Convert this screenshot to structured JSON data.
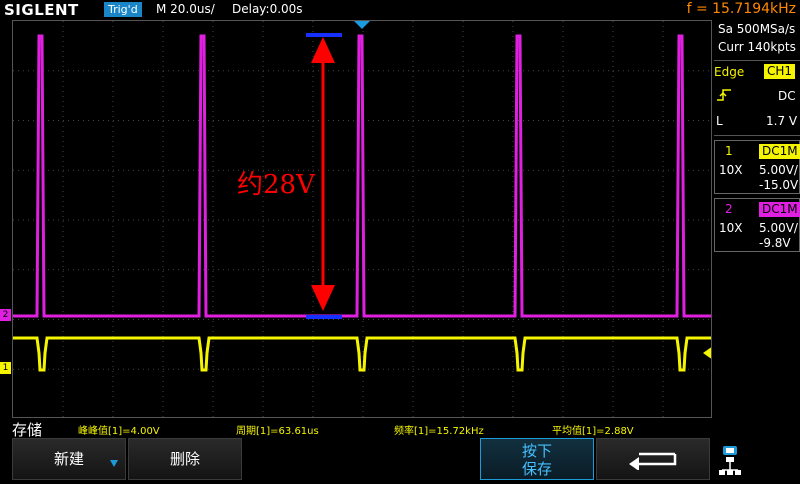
{
  "header": {
    "brand": "SIGLENT",
    "trigger_status": "Trig'd",
    "timebase": "M 20.0us/",
    "delay": "Delay:0.00s",
    "frequency": "f = 15.7194kHz"
  },
  "side_panel": {
    "sample_rate": "Sa 500MSa/s",
    "memory_depth": "Curr 140kpts",
    "trigger": {
      "type_label": "Edge",
      "source": "CH1",
      "coupling": "DC",
      "level_label": "L",
      "level": "1.7 V"
    },
    "channels": [
      {
        "number": "1",
        "coupling": "DC1M",
        "probe": "10X",
        "scale": "5.00V/",
        "offset": "-15.0V",
        "color": "#f5f500"
      },
      {
        "number": "2",
        "coupling": "DC1M",
        "probe": "10X",
        "scale": "5.00V/",
        "offset": "-9.8V",
        "color": "#e020e0"
      }
    ]
  },
  "annotation": {
    "text": "约28V",
    "color": "#ff0000"
  },
  "markers": {
    "ch1": "1",
    "ch2": "2"
  },
  "measurements": {
    "label": "存储",
    "items": [
      "峰峰值[1]=4.00V",
      "周期[1]=63.61us",
      "频率[1]=15.72kHz",
      "平均值[1]=2.88V"
    ]
  },
  "softkeys": {
    "new_label": "新建",
    "delete_label": "删除",
    "save_label_line1": "按下",
    "save_label_line2": "保存"
  },
  "colors": {
    "ch1": "#f5f500",
    "ch2": "#e020e0",
    "accent": "#1a86c7",
    "freq": "#ff8800"
  }
}
